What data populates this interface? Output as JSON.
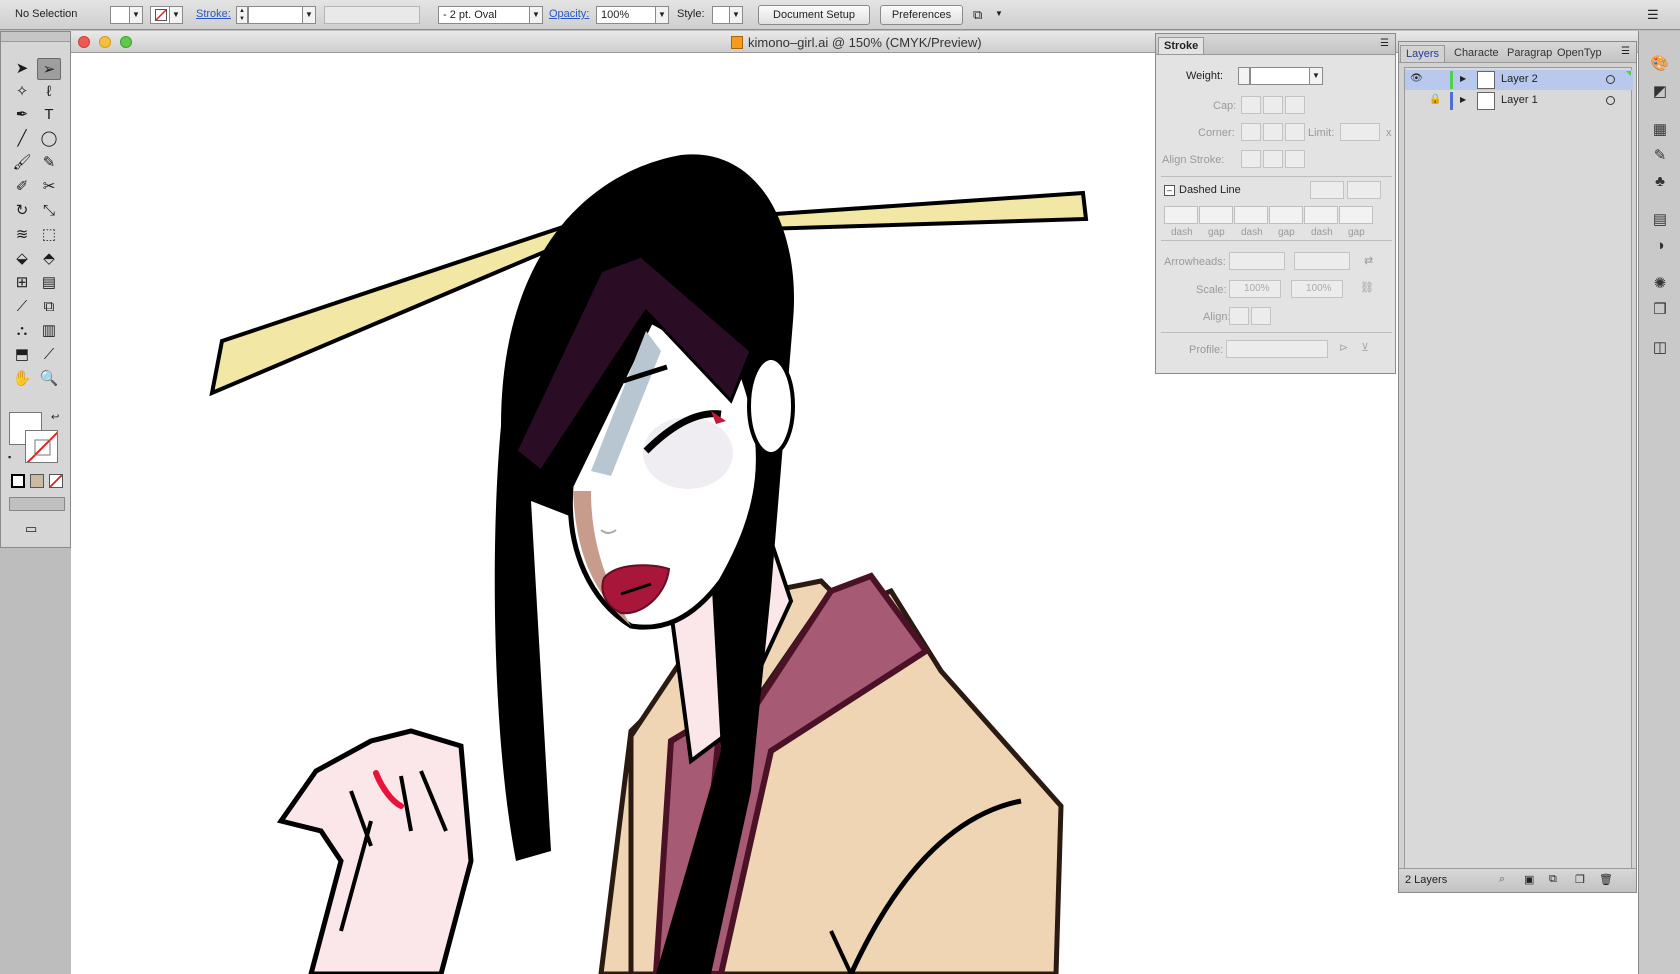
{
  "control_bar": {
    "selection": "No Selection",
    "stroke_label": "Stroke:",
    "brush": "2 pt. Oval",
    "opacity_label": "Opacity:",
    "opacity": "100%",
    "style_label": "Style:",
    "document_setup": "Document Setup",
    "preferences": "Preferences"
  },
  "document": {
    "title": "kimono–girl.ai @ 150% (CMYK/Preview)"
  },
  "stroke_panel": {
    "tab": "Stroke",
    "weight": "Weight:",
    "cap": "Cap:",
    "corner": "Corner:",
    "limit": "Limit:",
    "limit_x": "x",
    "align_stroke": "Align Stroke:",
    "dashed_line": "Dashed Line",
    "dash": "dash",
    "gap": "gap",
    "arrowheads": "Arrowheads:",
    "scale": "Scale:",
    "scale_1": "100%",
    "scale_2": "100%",
    "align": "Align:",
    "profile": "Profile:"
  },
  "layers_panel": {
    "tabs": [
      "Layers",
      "Characte",
      "Paragrap",
      "OpenTyp"
    ],
    "layers": [
      {
        "name": "Layer 2",
        "color": "#4fd14f",
        "selected": true
      },
      {
        "name": "Layer 1",
        "color": "#4f6fd6",
        "selected": false
      }
    ],
    "count": "2 Layers"
  },
  "colors": {
    "hair": "#000000",
    "hair_band": "#2a0c24",
    "stick": "#f2e7a4",
    "skin": "#ffffff",
    "skin_shadow": "#c89c8c",
    "lips": "#a8163a",
    "kimono_collar": "#a75a73",
    "kimono": "#efd5b4",
    "collar_outline": "#4b1227",
    "underlayer": "#fbe6ea"
  }
}
